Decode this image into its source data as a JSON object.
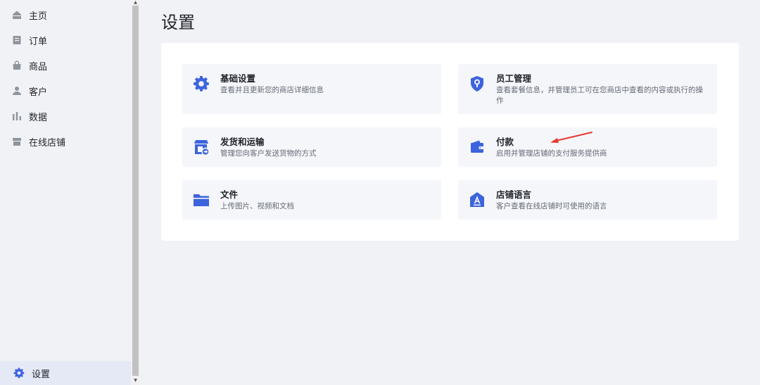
{
  "sidebar": {
    "items": [
      {
        "label": "主页",
        "icon": "home-icon"
      },
      {
        "label": "订单",
        "icon": "orders-icon"
      },
      {
        "label": "商品",
        "icon": "products-icon"
      },
      {
        "label": "客户",
        "icon": "customer-icon"
      },
      {
        "label": "数据",
        "icon": "analytics-icon"
      },
      {
        "label": "在线店铺",
        "icon": "store-icon"
      }
    ],
    "settings": {
      "label": "设置",
      "icon": "gear-icon"
    }
  },
  "main": {
    "title": "设置",
    "cards": [
      {
        "title": "基础设置",
        "desc": "查看并且更新您的商店详细信息",
        "icon": "gear-icon"
      },
      {
        "title": "员工管理",
        "desc": "查看套餐信息，并管理员工可在您商店中查看的内容或执行的操作",
        "icon": "shield-icon"
      },
      {
        "title": "发货和运输",
        "desc": "管理您向客户发送货物的方式",
        "icon": "shipping-icon"
      },
      {
        "title": "付款",
        "desc": "启用并管理店铺的支付服务提供商",
        "icon": "wallet-icon"
      },
      {
        "title": "文件",
        "desc": "上传图片、视频和文档",
        "icon": "folder-icon"
      },
      {
        "title": "店铺语言",
        "desc": "客户查看在线店铺时可使用的语言",
        "icon": "language-icon"
      }
    ]
  },
  "colors": {
    "accent": "#3d63dd",
    "nav_icon": "#8f959e",
    "annotation_arrow": "#e53a2f"
  }
}
